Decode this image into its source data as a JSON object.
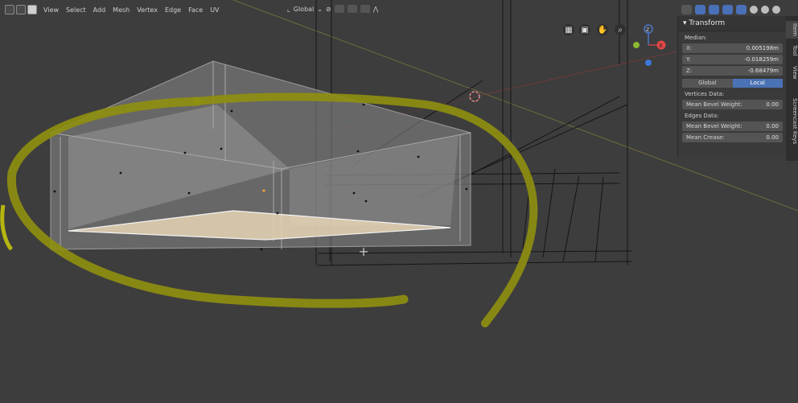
{
  "header": {
    "menu": [
      "View",
      "Select",
      "Add",
      "Mesh",
      "Vertex",
      "Edge",
      "Face",
      "UV"
    ],
    "orientation": "Global"
  },
  "colors": {
    "accent": "#4b72b4",
    "annotation": "#8f8f10",
    "selection": "#f0a040"
  },
  "panel": {
    "title": "Transform",
    "median_label": "Median:",
    "x_label": "X:",
    "x_value": "0.005198m",
    "y_label": "Y:",
    "y_value": "-0.018259m",
    "z_label": "Z:",
    "z_value": "-0.68479m",
    "global_label": "Global",
    "local_label": "Local",
    "vertices_label": "Vertices Data:",
    "v_bevel_label": "Mean Bevel Weight:",
    "v_bevel_value": "0.00",
    "edges_label": "Edges Data:",
    "e_bevel_label": "Mean Bevel Weight:",
    "e_bevel_value": "0.00",
    "crease_label": "Mean Crease:",
    "crease_value": "0.00"
  },
  "tabs": [
    "Item",
    "Tool",
    "View",
    "Screencast Keys"
  ],
  "gizmo": {
    "x": "X",
    "y": "Y",
    "z": "Z"
  },
  "nav_icons": [
    "grid-icon",
    "camera-icon",
    "hand-icon",
    "zoom-icon"
  ]
}
